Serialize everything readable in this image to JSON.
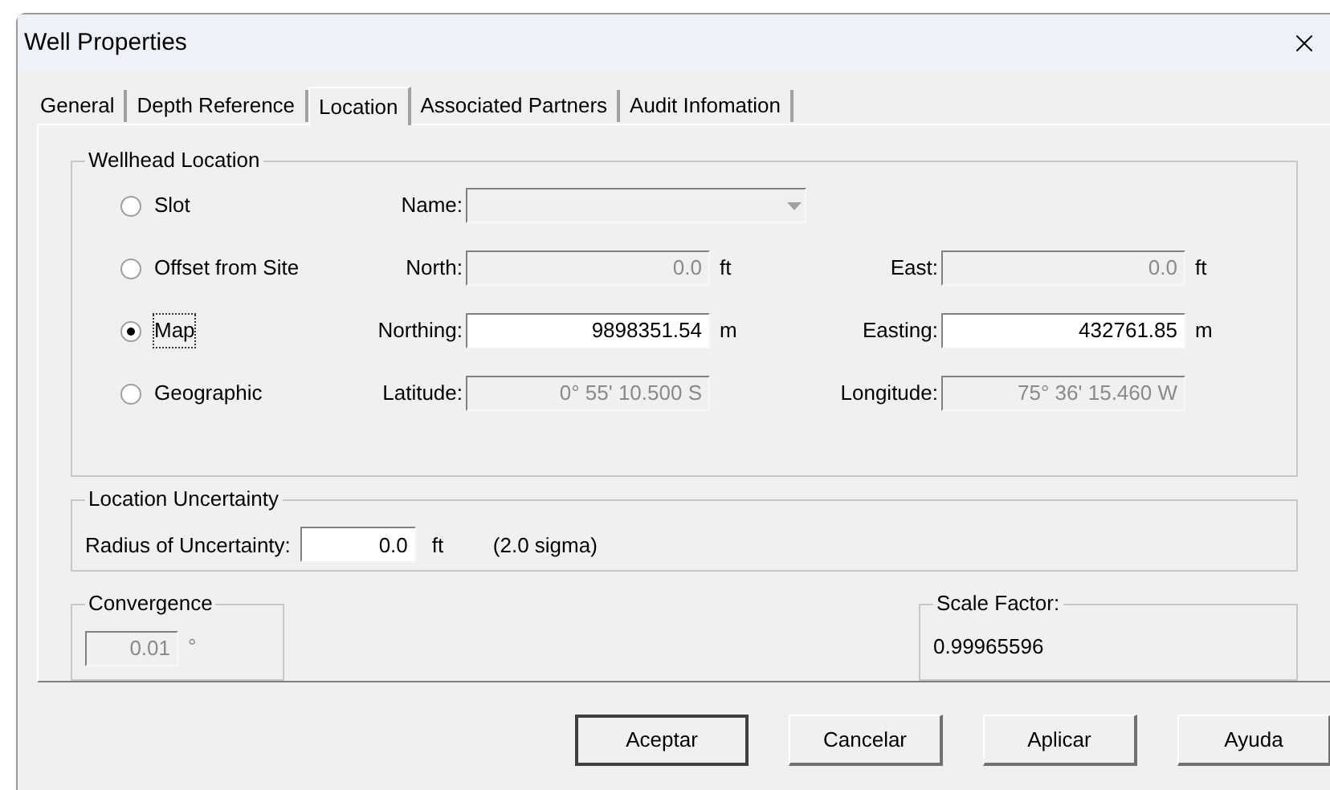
{
  "window": {
    "title": "Well Properties"
  },
  "tabs": [
    {
      "label": "General",
      "selected": false
    },
    {
      "label": "Depth Reference",
      "selected": false
    },
    {
      "label": "Location",
      "selected": true
    },
    {
      "label": "Associated Partners",
      "selected": false
    },
    {
      "label": "Audit Infomation",
      "selected": false
    }
  ],
  "wellhead_location": {
    "title": "Wellhead Location",
    "options": [
      {
        "label": "Slot",
        "selected": false,
        "fields": [
          {
            "kind": "dropdown",
            "label": "Name:",
            "disabled": true
          }
        ]
      },
      {
        "label": "Offset from Site",
        "selected": false,
        "fields": [
          {
            "kind": "text",
            "label": "North:",
            "value": "0.0",
            "unit": "ft",
            "disabled": true
          },
          {
            "kind": "text",
            "label": "East:",
            "value": "0.0",
            "unit": "ft",
            "disabled": true
          }
        ]
      },
      {
        "label": "Map",
        "selected": true,
        "fields": [
          {
            "kind": "text",
            "label": "Northing:",
            "value": "9898351.54",
            "unit": "m",
            "disabled": false
          },
          {
            "kind": "text",
            "label": "Easting:",
            "value": "432761.85",
            "unit": "m",
            "disabled": false
          }
        ]
      },
      {
        "label": "Geographic",
        "selected": false,
        "fields": [
          {
            "kind": "text",
            "label": "Latitude:",
            "value": "0° 55' 10.500 S",
            "disabled": true
          },
          {
            "kind": "text",
            "label": "Longitude:",
            "value": "75° 36' 15.460 W",
            "disabled": true
          }
        ]
      }
    ]
  },
  "location_uncertainty": {
    "title": "Location Uncertainty",
    "label": "Radius of Uncertainty:",
    "value": "0.0",
    "unit": "ft",
    "note": "(2.0 sigma)"
  },
  "convergence": {
    "title": "Convergence",
    "value": "0.01",
    "unit": "°",
    "disabled": true
  },
  "scale_factor": {
    "title": "Scale Factor:",
    "value": "0.99965596"
  },
  "buttons": [
    {
      "label": "Aceptar",
      "default": true
    },
    {
      "label": "Cancelar",
      "default": false
    },
    {
      "label": "Aplicar",
      "default": false
    },
    {
      "label": "Ayuda",
      "default": false
    }
  ]
}
